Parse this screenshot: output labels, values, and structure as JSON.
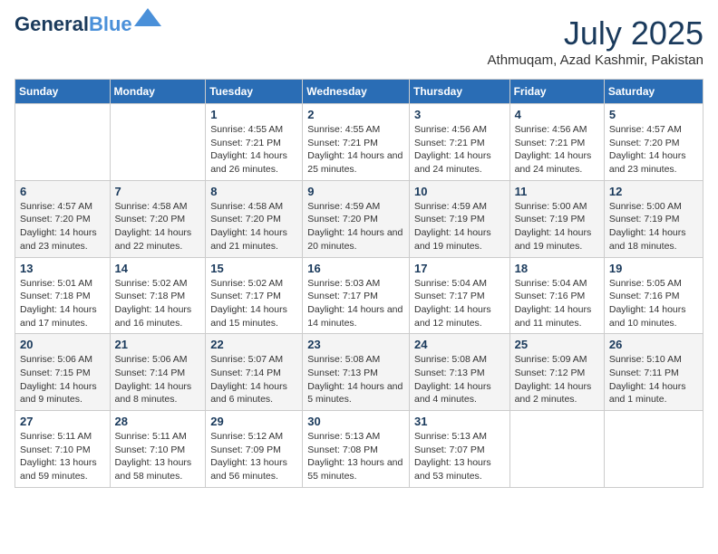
{
  "logo": {
    "line1": "General",
    "line2": "Blue"
  },
  "header": {
    "month": "July 2025",
    "location": "Athmuqam, Azad Kashmir, Pakistan"
  },
  "weekdays": [
    "Sunday",
    "Monday",
    "Tuesday",
    "Wednesday",
    "Thursday",
    "Friday",
    "Saturday"
  ],
  "weeks": [
    [
      {
        "day": "",
        "info": ""
      },
      {
        "day": "",
        "info": ""
      },
      {
        "day": "1",
        "info": "Sunrise: 4:55 AM\nSunset: 7:21 PM\nDaylight: 14 hours and 26 minutes."
      },
      {
        "day": "2",
        "info": "Sunrise: 4:55 AM\nSunset: 7:21 PM\nDaylight: 14 hours and 25 minutes."
      },
      {
        "day": "3",
        "info": "Sunrise: 4:56 AM\nSunset: 7:21 PM\nDaylight: 14 hours and 24 minutes."
      },
      {
        "day": "4",
        "info": "Sunrise: 4:56 AM\nSunset: 7:21 PM\nDaylight: 14 hours and 24 minutes."
      },
      {
        "day": "5",
        "info": "Sunrise: 4:57 AM\nSunset: 7:20 PM\nDaylight: 14 hours and 23 minutes."
      }
    ],
    [
      {
        "day": "6",
        "info": "Sunrise: 4:57 AM\nSunset: 7:20 PM\nDaylight: 14 hours and 23 minutes."
      },
      {
        "day": "7",
        "info": "Sunrise: 4:58 AM\nSunset: 7:20 PM\nDaylight: 14 hours and 22 minutes."
      },
      {
        "day": "8",
        "info": "Sunrise: 4:58 AM\nSunset: 7:20 PM\nDaylight: 14 hours and 21 minutes."
      },
      {
        "day": "9",
        "info": "Sunrise: 4:59 AM\nSunset: 7:20 PM\nDaylight: 14 hours and 20 minutes."
      },
      {
        "day": "10",
        "info": "Sunrise: 4:59 AM\nSunset: 7:19 PM\nDaylight: 14 hours and 19 minutes."
      },
      {
        "day": "11",
        "info": "Sunrise: 5:00 AM\nSunset: 7:19 PM\nDaylight: 14 hours and 19 minutes."
      },
      {
        "day": "12",
        "info": "Sunrise: 5:00 AM\nSunset: 7:19 PM\nDaylight: 14 hours and 18 minutes."
      }
    ],
    [
      {
        "day": "13",
        "info": "Sunrise: 5:01 AM\nSunset: 7:18 PM\nDaylight: 14 hours and 17 minutes."
      },
      {
        "day": "14",
        "info": "Sunrise: 5:02 AM\nSunset: 7:18 PM\nDaylight: 14 hours and 16 minutes."
      },
      {
        "day": "15",
        "info": "Sunrise: 5:02 AM\nSunset: 7:17 PM\nDaylight: 14 hours and 15 minutes."
      },
      {
        "day": "16",
        "info": "Sunrise: 5:03 AM\nSunset: 7:17 PM\nDaylight: 14 hours and 14 minutes."
      },
      {
        "day": "17",
        "info": "Sunrise: 5:04 AM\nSunset: 7:17 PM\nDaylight: 14 hours and 12 minutes."
      },
      {
        "day": "18",
        "info": "Sunrise: 5:04 AM\nSunset: 7:16 PM\nDaylight: 14 hours and 11 minutes."
      },
      {
        "day": "19",
        "info": "Sunrise: 5:05 AM\nSunset: 7:16 PM\nDaylight: 14 hours and 10 minutes."
      }
    ],
    [
      {
        "day": "20",
        "info": "Sunrise: 5:06 AM\nSunset: 7:15 PM\nDaylight: 14 hours and 9 minutes."
      },
      {
        "day": "21",
        "info": "Sunrise: 5:06 AM\nSunset: 7:14 PM\nDaylight: 14 hours and 8 minutes."
      },
      {
        "day": "22",
        "info": "Sunrise: 5:07 AM\nSunset: 7:14 PM\nDaylight: 14 hours and 6 minutes."
      },
      {
        "day": "23",
        "info": "Sunrise: 5:08 AM\nSunset: 7:13 PM\nDaylight: 14 hours and 5 minutes."
      },
      {
        "day": "24",
        "info": "Sunrise: 5:08 AM\nSunset: 7:13 PM\nDaylight: 14 hours and 4 minutes."
      },
      {
        "day": "25",
        "info": "Sunrise: 5:09 AM\nSunset: 7:12 PM\nDaylight: 14 hours and 2 minutes."
      },
      {
        "day": "26",
        "info": "Sunrise: 5:10 AM\nSunset: 7:11 PM\nDaylight: 14 hours and 1 minute."
      }
    ],
    [
      {
        "day": "27",
        "info": "Sunrise: 5:11 AM\nSunset: 7:10 PM\nDaylight: 13 hours and 59 minutes."
      },
      {
        "day": "28",
        "info": "Sunrise: 5:11 AM\nSunset: 7:10 PM\nDaylight: 13 hours and 58 minutes."
      },
      {
        "day": "29",
        "info": "Sunrise: 5:12 AM\nSunset: 7:09 PM\nDaylight: 13 hours and 56 minutes."
      },
      {
        "day": "30",
        "info": "Sunrise: 5:13 AM\nSunset: 7:08 PM\nDaylight: 13 hours and 55 minutes."
      },
      {
        "day": "31",
        "info": "Sunrise: 5:13 AM\nSunset: 7:07 PM\nDaylight: 13 hours and 53 minutes."
      },
      {
        "day": "",
        "info": ""
      },
      {
        "day": "",
        "info": ""
      }
    ]
  ]
}
